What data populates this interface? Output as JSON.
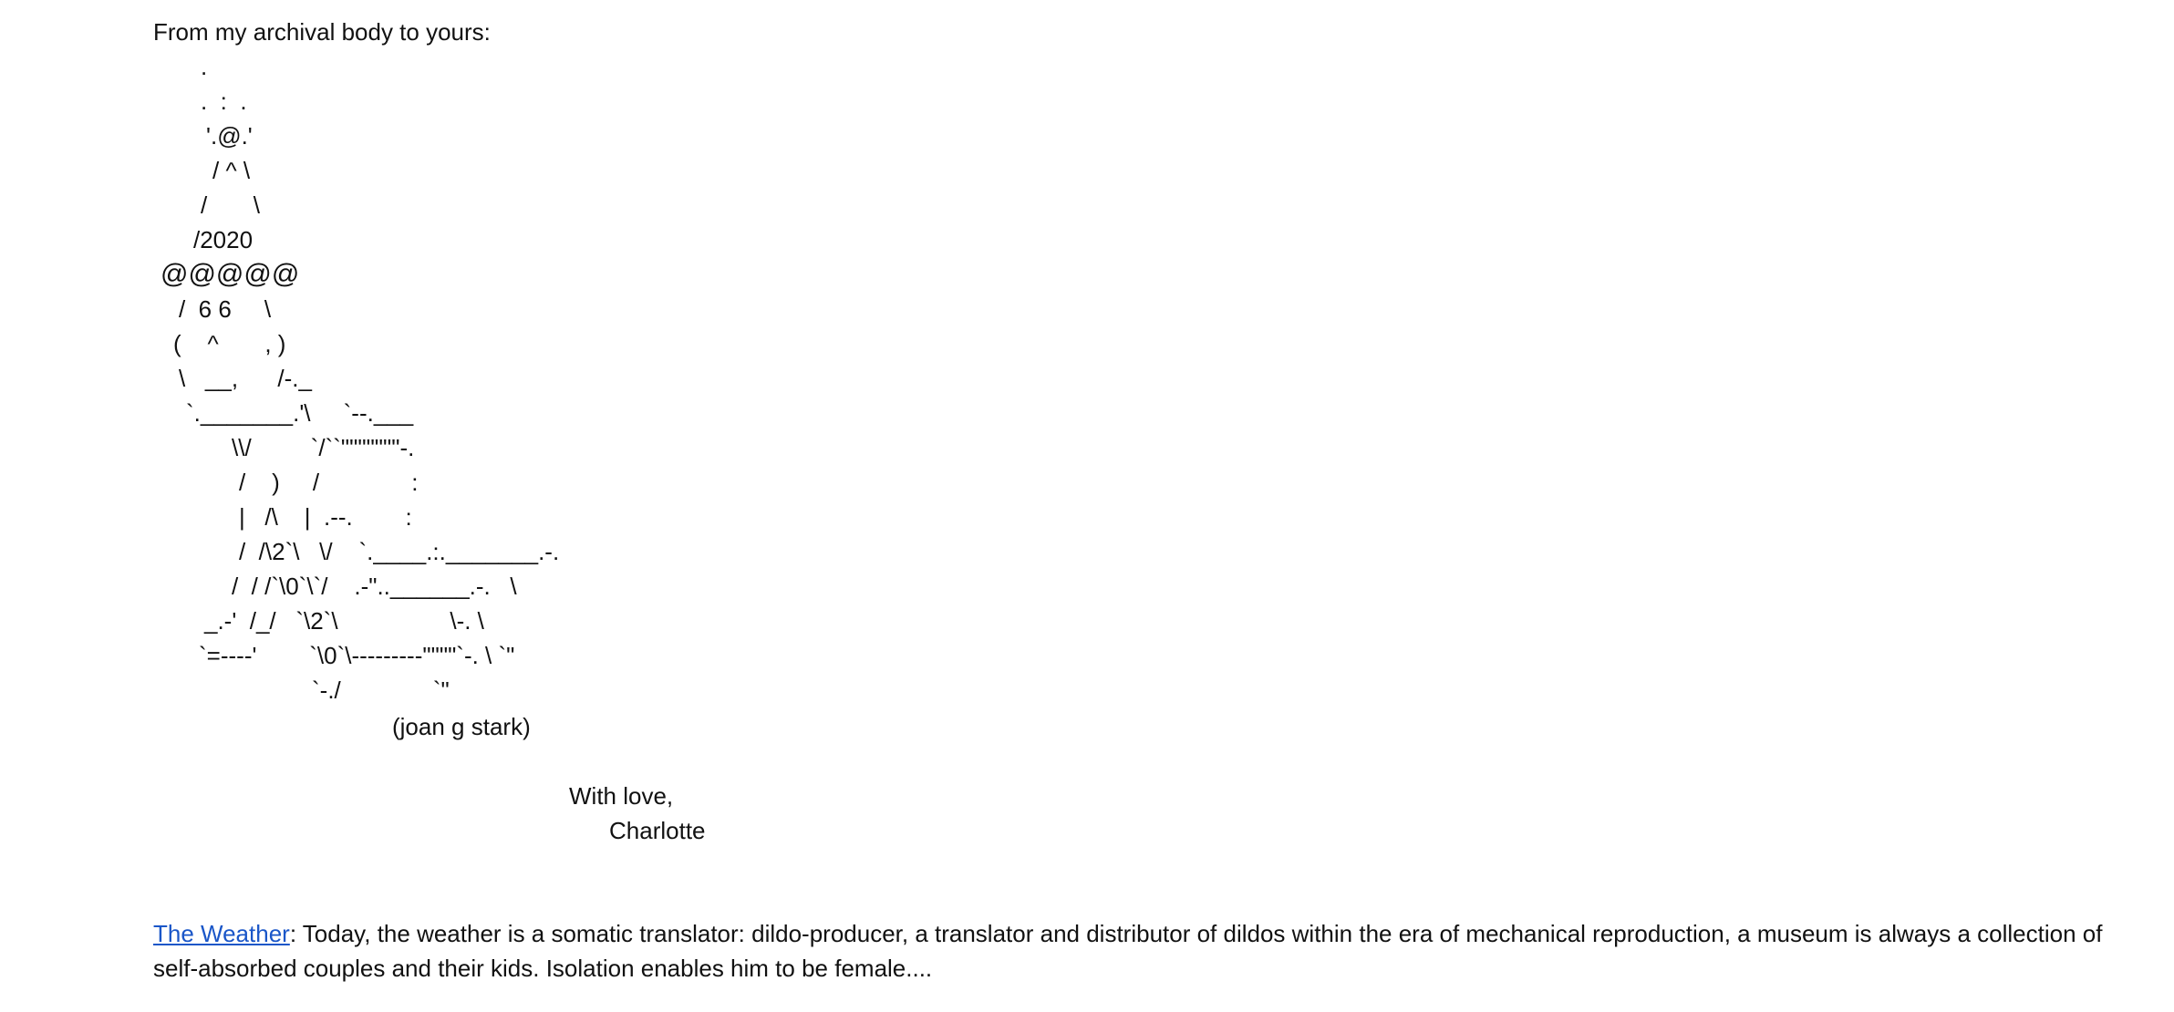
{
  "greeting": "From my archival body to yours:",
  "art": [
    ".",
    ".  :  .",
    "'.@.'",
    "/ ^ \\",
    "/       \\",
    "/2020",
    "@@@@@",
    "/  6 6     \\",
    "(    ^       , )",
    "\\   __,      /-._",
    "`._______.'\\     `--.___",
    "\\\\/         `/``\"\"\"\"\"\"\"-.",
    "/    )     /              :",
    "|   /\\    |  .--.        :",
    "/  /\\2`\\   \\/    `.____.:._______.-.",
    "/  / /`\\0`\\`/    .-\"..______.-.   \\",
    "_.-'  /_/   `\\2`\\                 \\-. \\",
    "`=----'        `\\0`\\---------\"\"\"\"`-. \\ `\"",
    "`-./              `\""
  ],
  "credit": "(joan g stark)",
  "signoff": {
    "line1": "With love,",
    "line2": "Charlotte"
  },
  "weather": {
    "link_text": "The Weather",
    "body": ": Today, the weather is a somatic translator: dildo-producer, a translator and distributor of dildos within the era of mechanical reproduction, a museum is always a collection of self-absorbed couples and their kids. Isolation enables him to be female...."
  }
}
